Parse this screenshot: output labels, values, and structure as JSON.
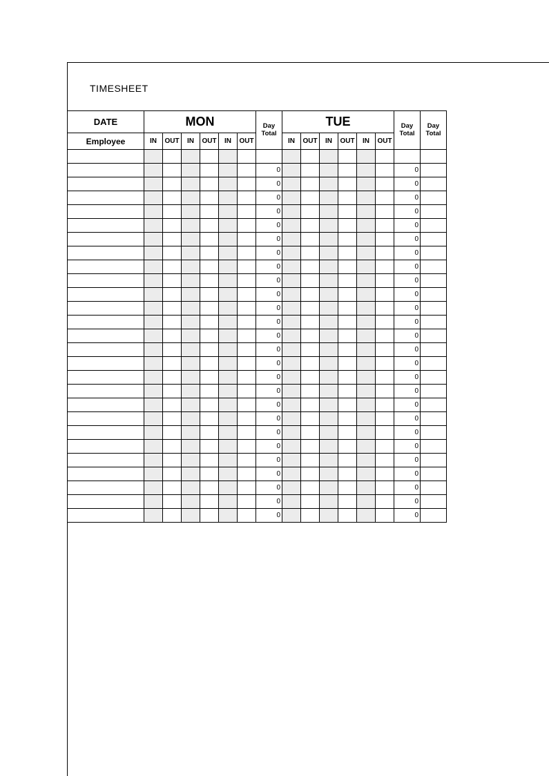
{
  "title": "TIMESHEET",
  "headers": {
    "date": "DATE",
    "employee": "Employee",
    "day_total": "Day Total",
    "in": "IN",
    "out": "OUT",
    "days": [
      "MON",
      "TUE"
    ]
  },
  "row_count": 26,
  "default_total": "0"
}
